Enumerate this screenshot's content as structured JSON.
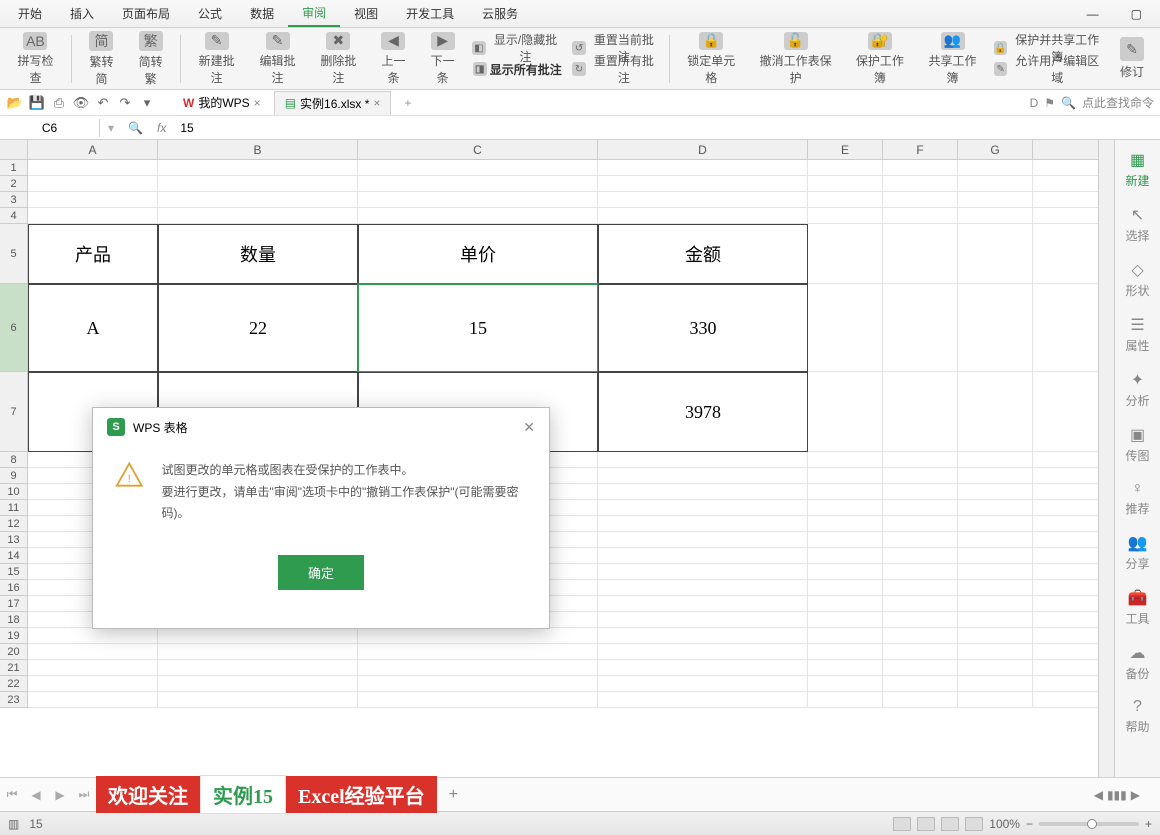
{
  "menu": {
    "items": [
      "开始",
      "插入",
      "页面布局",
      "公式",
      "数据",
      "审阅",
      "视图",
      "开发工具",
      "云服务"
    ],
    "active": 5
  },
  "ribbon": {
    "spell": "拼写检查",
    "trad2simp": "繁转简",
    "simp2trad": "简转繁",
    "newcmt": "新建批注",
    "editcmt": "编辑批注",
    "delcmt": "删除批注",
    "prevcmt": "上一条",
    "nextcmt": "下一条",
    "showhide": "显示/隐藏批注",
    "resetcur": "重置当前批注",
    "showall": "显示所有批注",
    "resetall": "重置所有批注",
    "lock": "锁定单元格",
    "unprotect": "撤消工作表保护",
    "protectwb": "保护工作簿",
    "sharewb": "共享工作簿",
    "protectshare": "保护并共享工作簿",
    "allowedit": "允许用户编辑区域",
    "track": "修订"
  },
  "qat": {
    "wps": "我的WPS",
    "file": "实例16.xlsx *",
    "search_ph": "点此查找命令"
  },
  "formula": {
    "cell": "C6",
    "value": "15"
  },
  "cols": {
    "A": 130,
    "B": 200,
    "C": 240,
    "D": 210,
    "E": 75,
    "F": 75,
    "G": 75,
    "H": 73
  },
  "table": {
    "headers": [
      "产品",
      "数量",
      "单价",
      "金额"
    ],
    "rows": [
      [
        "A",
        "22",
        "15",
        "330"
      ],
      [
        "",
        "",
        "",
        "3978"
      ]
    ]
  },
  "side": {
    "new": "新建",
    "select": "选择",
    "shape": "形状",
    "prop": "属性",
    "analyze": "分析",
    "send": "传图",
    "recommend": "推荐",
    "share": "分享",
    "tool": "工具",
    "backup": "备份",
    "help": "帮助"
  },
  "sheets": {
    "s1": "欢迎关注",
    "s2": "实例15",
    "s3": "Excel经验平台",
    "add": "+"
  },
  "status": {
    "val": "15",
    "zoom": "100%"
  },
  "dialog": {
    "title": "WPS 表格",
    "msg1": "试图更改的单元格或图表在受保护的工作表中。",
    "msg2": "要进行更改，请单击\"审阅\"选项卡中的\"撤销工作表保护\"(可能需要密码)。",
    "ok": "确定"
  }
}
